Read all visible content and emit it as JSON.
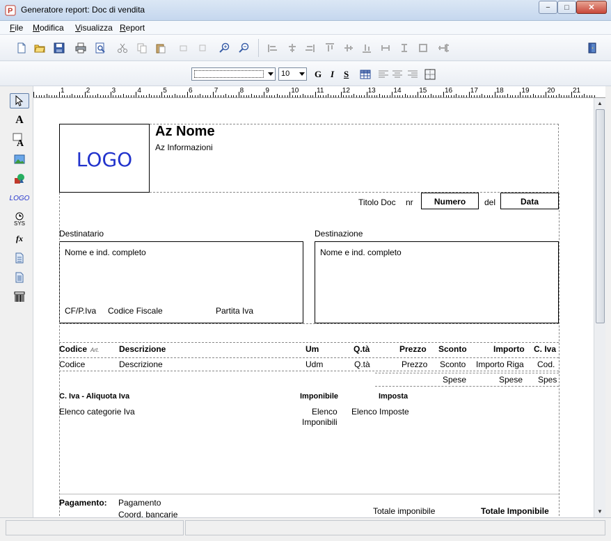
{
  "window": {
    "title": "Generatore report: Doc di vendita",
    "minimize": "−",
    "maximize": "□",
    "close": "✕"
  },
  "menu": [
    {
      "label": "File",
      "accel": "F",
      "rest": "ile"
    },
    {
      "label": "Modifica",
      "accel": "M",
      "rest": "odifica"
    },
    {
      "label": "Visualizza",
      "accel": "V",
      "rest": "isualizza"
    },
    {
      "label": "Report",
      "accel": "R",
      "rest": "eport"
    }
  ],
  "toolbar": {
    "font_name": "",
    "font_size": "10",
    "bold": "G",
    "italic": "I",
    "underline": "S"
  },
  "ruler": {
    "numbers": [
      "1",
      "2",
      "3",
      "4",
      "5",
      "6",
      "7",
      "8",
      "9",
      "10",
      "11",
      "12",
      "13",
      "14",
      "15",
      "16",
      "17",
      "18",
      "19",
      "20",
      "21"
    ]
  },
  "report": {
    "logo": "LOGO",
    "company_name": "Az Nome",
    "company_info": "Az Informazioni",
    "doc_title": "Titolo Doc",
    "nr": "nr",
    "number": "Numero",
    "del": "del",
    "date": "Data",
    "recipient_label": "Destinatario",
    "destination_label": "Destinazione",
    "recipient_full": "Nome e ind. completo",
    "destination_full": "Nome e ind. completo",
    "cf_piva": "CF/P.Iva",
    "codice_fiscale": "Codice Fiscale",
    "partita_iva": "Partita Iva",
    "col_headers": {
      "codice": "Codice",
      "codice_suffix": "Art.",
      "descrizione": "Descrizione",
      "um": "Um",
      "qta": "Q.tà",
      "prezzo": "Prezzo",
      "sconto": "Sconto",
      "importo": "Importo",
      "civa": "C. Iva"
    },
    "row_fields": {
      "codice": "Codice",
      "descrizione": "Descrizione",
      "um": "Udm",
      "qta": "Q.tà",
      "prezzo": "Prezzo",
      "sconto": "Sconto",
      "importo": "Importo Riga",
      "civa": "Cod."
    },
    "spese_row": {
      "spese1": "Spese",
      "spese2": "Spese",
      "spese3": "Spes"
    },
    "vat_header": "C. Iva - Aliquota Iva",
    "vat_list": "Elenco categorie Iva",
    "imponibile_header": "Imponibile",
    "imponibile_list_1": "Elenco",
    "imponibile_list_2": "Imponibili",
    "imposta_header": "Imposta",
    "imposta_list": "Elenco Imposte",
    "payment_label": "Pagamento:",
    "payment_value": "Pagamento",
    "bank_coords": "Coord. bancarie",
    "totale_imponibile_label": "Totale imponibile",
    "totale_imponibile_value": "Totale Imponibile"
  },
  "palette": [
    "pointer-tool",
    "text-tool",
    "framed-text-tool",
    "image-tool",
    "shapes-tool",
    "logo-tool",
    "system-field-tool",
    "formula-tool",
    "subreport-tool",
    "subreport2-tool",
    "barcode-tool"
  ],
  "palette_labels": {
    "logo": "LOGO",
    "sys": "SYS",
    "fx": "fx"
  }
}
